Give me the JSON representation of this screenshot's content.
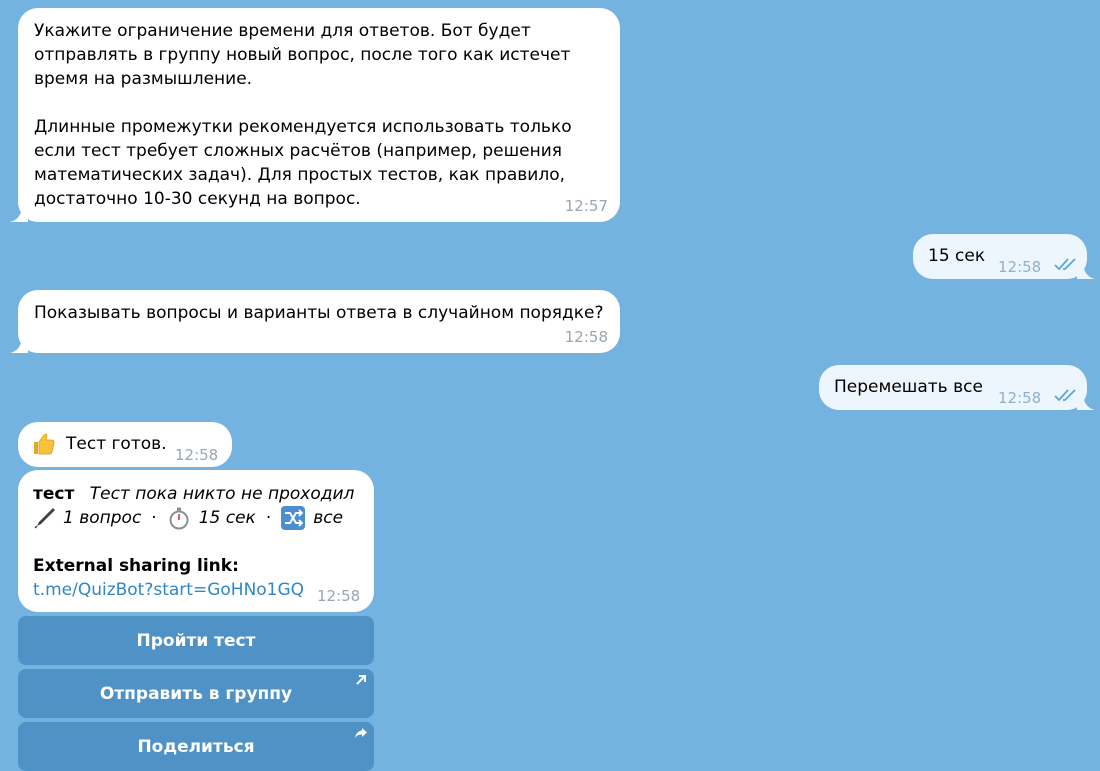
{
  "messages": {
    "bot_time_limit": {
      "para1": "Укажите ограничение времени для ответов. Бот будет отправлять в группу новый вопрос, после того как истечет время на размышление.",
      "para2": "Длинные промежутки рекомендуется использовать только если тест требует сложных расчётов (например, решения математических задач). Для простых тестов, как правило, достаточно 10-30 секунд на вопрос.",
      "time": "12:57"
    },
    "user_time": {
      "text": "15 сек",
      "time": "12:58"
    },
    "bot_shuffle": {
      "text": "Показывать вопросы и варианты ответа в случайном порядке?",
      "time": "12:58"
    },
    "user_shuffle": {
      "text": "Перемешать все",
      "time": "12:58"
    },
    "bot_ready": {
      "text": "Тест готов.",
      "time": "12:58",
      "icon": "thumbs-up-icon"
    },
    "bot_quiz_card": {
      "title": "тест",
      "subtitle": "Тест пока никто не проходил",
      "questions": "1 вопрос",
      "duration": "15 сек",
      "shuffle": "все",
      "separator": "·",
      "sharing_label": "External sharing link:",
      "link": "t.me/QuizBot?start=GoHNo1GQ",
      "time": "12:58"
    }
  },
  "buttons": {
    "start": "Пройти тест",
    "send_group": "Отправить в группу",
    "share": "Поделиться"
  },
  "colors": {
    "background": "#74b2e0",
    "incoming_bubble": "#ffffff",
    "outgoing_bubble": "#eef6fd",
    "button": "#4f93c6",
    "link": "#2f87c8",
    "read_ticks": "#5aa5df"
  }
}
